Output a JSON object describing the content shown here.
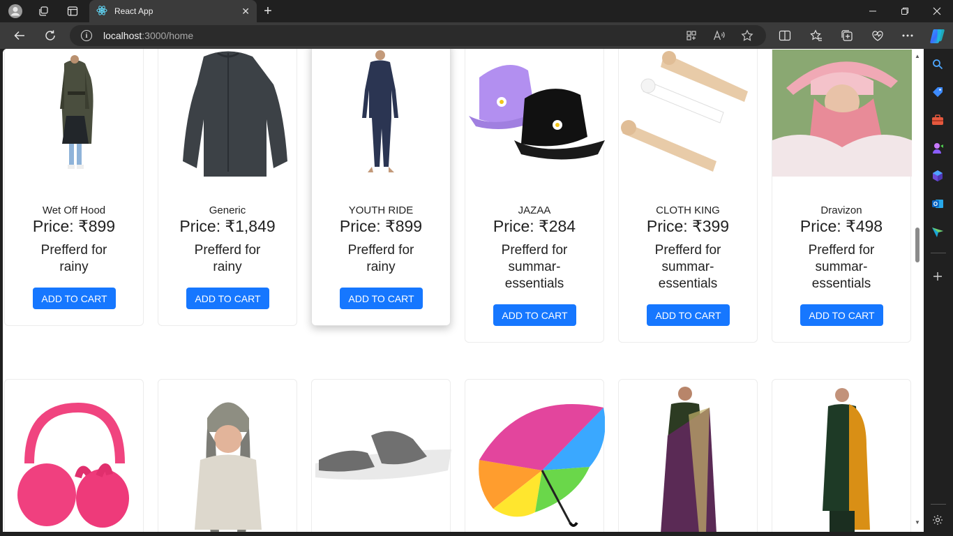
{
  "browser": {
    "tab_title": "React App",
    "url_host": "localhost",
    "url_path": ":3000/home"
  },
  "products_row1": [
    {
      "brand": "Wet Off Hood",
      "price": "Price: ₹899",
      "pref": "Prefferd for rainy",
      "button": "ADD TO CART"
    },
    {
      "brand": "Generic",
      "price": "Price: ₹1,849",
      "pref": "Prefferd for rainy",
      "button": "ADD TO CART"
    },
    {
      "brand": "YOUTH RIDE",
      "price": "Price: ₹899",
      "pref": "Prefferd for rainy",
      "button": "ADD TO CART"
    },
    {
      "brand": "JAZAA",
      "price": "Price: ₹284",
      "pref": "Prefferd for summar-essentials",
      "button": "ADD TO CART"
    },
    {
      "brand": "CLOTH KING",
      "price": "Price: ₹399",
      "pref": "Prefferd for summar-essentials",
      "button": "ADD TO CART"
    },
    {
      "brand": "Dravizon",
      "price": "Price: ₹498",
      "pref": "Prefferd for summar-essentials",
      "button": "ADD TO CART"
    }
  ],
  "colors": {
    "button": "#1677ff",
    "browser_chrome": "#202020"
  }
}
